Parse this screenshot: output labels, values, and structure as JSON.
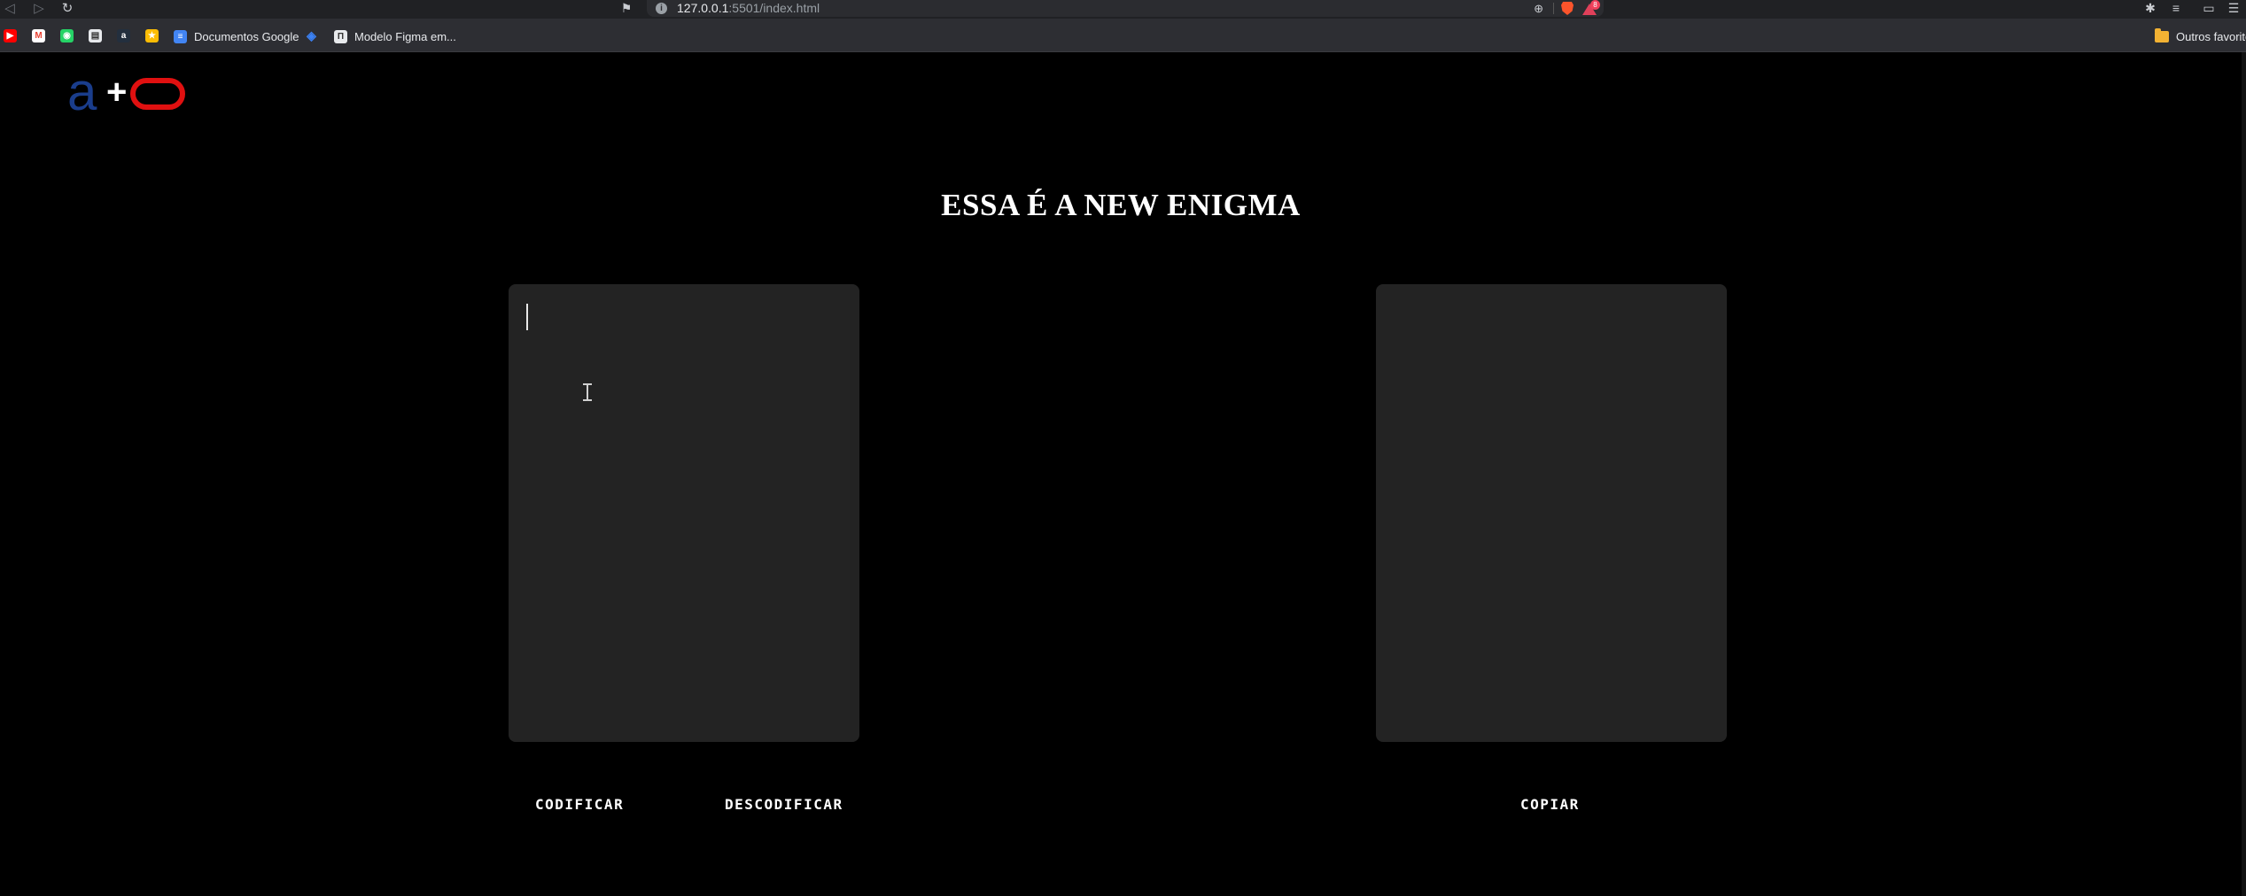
{
  "browser": {
    "address": {
      "host": "127.0.0.1",
      "rest": ":5501/index.html"
    },
    "bookmarks": [
      {
        "label": "",
        "icon": "youtube-icon",
        "color": "#ff0000"
      },
      {
        "label": "",
        "icon": "gmail-icon",
        "color": "#ea4335"
      },
      {
        "label": "",
        "icon": "whatsapp-icon",
        "color": "#25d366"
      },
      {
        "label": "",
        "icon": "page-icon",
        "color": "#e8eaed"
      },
      {
        "label": "",
        "icon": "amazon-icon",
        "color": "#232f3e"
      },
      {
        "label": "",
        "icon": "keep-icon",
        "color": "#fbbc04"
      },
      {
        "label": "Documentos Google",
        "icon": "docs-icon",
        "color": "#4285f4"
      },
      {
        "label": "",
        "icon": "vscode-icon",
        "color": "#3b82f6"
      },
      {
        "label": "Modelo Figma em...",
        "icon": "template-icon",
        "color": "#e8eaed"
      }
    ],
    "other_bookmarks": "Outros favoritos",
    "rewards_badge": "8"
  },
  "logo": {
    "left": "a",
    "plus": "+",
    "colors": {
      "a": "#1a3d8c",
      "ring": "#e01010"
    }
  },
  "page": {
    "title": "ESSA É A NEW ENIGMA"
  },
  "input_panel": {
    "value": ""
  },
  "output_panel": {
    "value": ""
  },
  "actions": {
    "encode": "CODIFICAR",
    "decode": "DESCODIFICAR",
    "copy": "COPIAR"
  }
}
